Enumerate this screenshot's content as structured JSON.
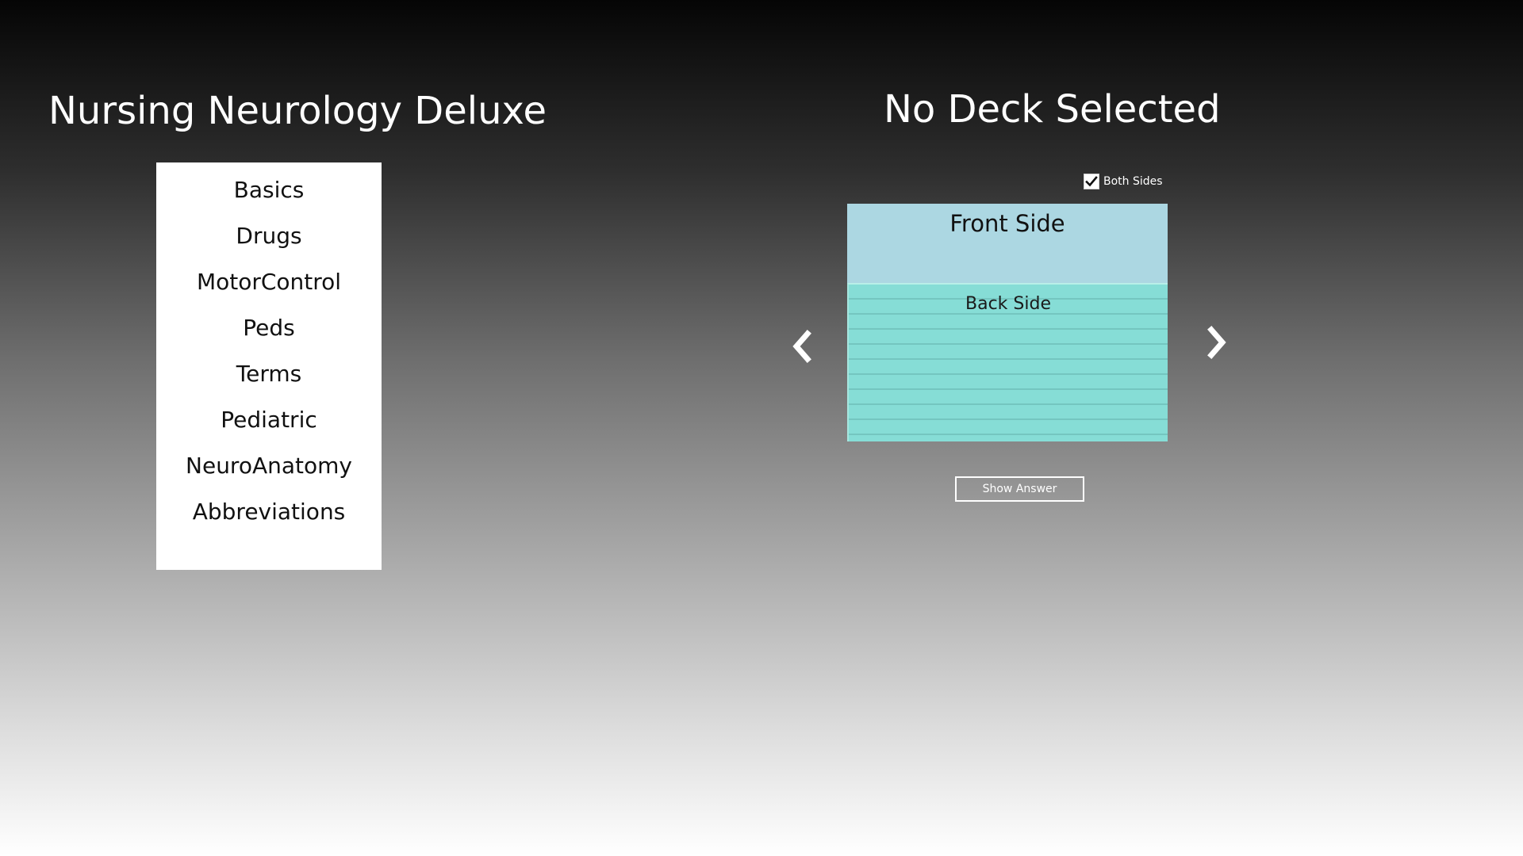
{
  "app": {
    "title": "Nursing Neurology Deluxe"
  },
  "decks": [
    {
      "label": "Basics"
    },
    {
      "label": "Drugs"
    },
    {
      "label": "MotorControl"
    },
    {
      "label": "Peds"
    },
    {
      "label": "Terms"
    },
    {
      "label": "Pediatric"
    },
    {
      "label": "NeuroAnatomy"
    },
    {
      "label": "Abbreviations"
    }
  ],
  "viewer": {
    "deck_title": "No Deck Selected",
    "both_sides_label": "Both Sides",
    "both_sides_checked": true,
    "front_text": "Front Side",
    "back_text": "Back Side",
    "show_answer_label": "Show Answer"
  },
  "icons": {
    "prev": "chevron-left-icon",
    "next": "chevron-right-icon",
    "check": "checkmark-icon"
  },
  "colors": {
    "front_card": "#acd7e2",
    "back_card": "#86ddd6",
    "list_background": "#ffffff",
    "text_light": "#ffffff"
  }
}
